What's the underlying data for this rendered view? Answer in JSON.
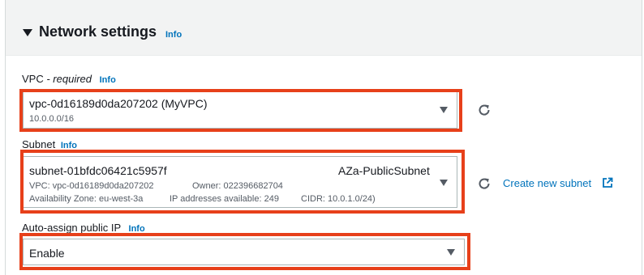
{
  "section": {
    "title": "Network settings",
    "info": "Info"
  },
  "vpc": {
    "label": "VPC",
    "required": "- required",
    "info": "Info",
    "value": "vpc-0d16189d0da207202 (MyVPC)",
    "cidr": "10.0.0.0/16"
  },
  "subnet": {
    "label": "Subnet",
    "info": "Info",
    "value": "subnet-01bfdc06421c5957f",
    "name": "AZa-PublicSubnet",
    "vpc": "VPC: vpc-0d16189d0da207202",
    "owner": "Owner: 022396682704",
    "az": "Availability Zone: eu-west-3a",
    "ips": "IP addresses available: 249",
    "cidr": "CIDR: 10.0.1.0/24)",
    "create_link": "Create new subnet"
  },
  "public_ip": {
    "label": "Auto-assign public IP",
    "info": "Info",
    "value": "Enable"
  },
  "colors": {
    "highlight": "#e7401a",
    "link": "#0073bb",
    "header_bg": "#f2f3f3"
  },
  "icons": [
    "caret-down-icon",
    "refresh-icon",
    "external-link-icon",
    "dropdown-arrow-icon"
  ]
}
